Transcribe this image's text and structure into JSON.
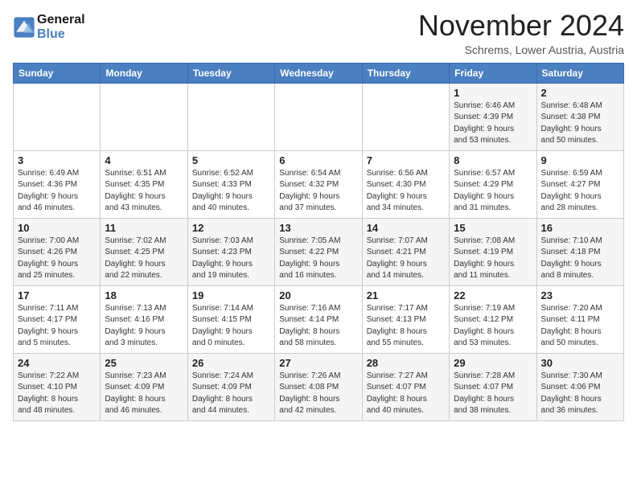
{
  "header": {
    "logo_line1": "General",
    "logo_line2": "Blue",
    "month": "November 2024",
    "location": "Schrems, Lower Austria, Austria"
  },
  "days_of_week": [
    "Sunday",
    "Monday",
    "Tuesday",
    "Wednesday",
    "Thursday",
    "Friday",
    "Saturday"
  ],
  "weeks": [
    [
      {
        "day": "",
        "info": ""
      },
      {
        "day": "",
        "info": ""
      },
      {
        "day": "",
        "info": ""
      },
      {
        "day": "",
        "info": ""
      },
      {
        "day": "",
        "info": ""
      },
      {
        "day": "1",
        "info": "Sunrise: 6:46 AM\nSunset: 4:39 PM\nDaylight: 9 hours\nand 53 minutes."
      },
      {
        "day": "2",
        "info": "Sunrise: 6:48 AM\nSunset: 4:38 PM\nDaylight: 9 hours\nand 50 minutes."
      }
    ],
    [
      {
        "day": "3",
        "info": "Sunrise: 6:49 AM\nSunset: 4:36 PM\nDaylight: 9 hours\nand 46 minutes."
      },
      {
        "day": "4",
        "info": "Sunrise: 6:51 AM\nSunset: 4:35 PM\nDaylight: 9 hours\nand 43 minutes."
      },
      {
        "day": "5",
        "info": "Sunrise: 6:52 AM\nSunset: 4:33 PM\nDaylight: 9 hours\nand 40 minutes."
      },
      {
        "day": "6",
        "info": "Sunrise: 6:54 AM\nSunset: 4:32 PM\nDaylight: 9 hours\nand 37 minutes."
      },
      {
        "day": "7",
        "info": "Sunrise: 6:56 AM\nSunset: 4:30 PM\nDaylight: 9 hours\nand 34 minutes."
      },
      {
        "day": "8",
        "info": "Sunrise: 6:57 AM\nSunset: 4:29 PM\nDaylight: 9 hours\nand 31 minutes."
      },
      {
        "day": "9",
        "info": "Sunrise: 6:59 AM\nSunset: 4:27 PM\nDaylight: 9 hours\nand 28 minutes."
      }
    ],
    [
      {
        "day": "10",
        "info": "Sunrise: 7:00 AM\nSunset: 4:26 PM\nDaylight: 9 hours\nand 25 minutes."
      },
      {
        "day": "11",
        "info": "Sunrise: 7:02 AM\nSunset: 4:25 PM\nDaylight: 9 hours\nand 22 minutes."
      },
      {
        "day": "12",
        "info": "Sunrise: 7:03 AM\nSunset: 4:23 PM\nDaylight: 9 hours\nand 19 minutes."
      },
      {
        "day": "13",
        "info": "Sunrise: 7:05 AM\nSunset: 4:22 PM\nDaylight: 9 hours\nand 16 minutes."
      },
      {
        "day": "14",
        "info": "Sunrise: 7:07 AM\nSunset: 4:21 PM\nDaylight: 9 hours\nand 14 minutes."
      },
      {
        "day": "15",
        "info": "Sunrise: 7:08 AM\nSunset: 4:19 PM\nDaylight: 9 hours\nand 11 minutes."
      },
      {
        "day": "16",
        "info": "Sunrise: 7:10 AM\nSunset: 4:18 PM\nDaylight: 9 hours\nand 8 minutes."
      }
    ],
    [
      {
        "day": "17",
        "info": "Sunrise: 7:11 AM\nSunset: 4:17 PM\nDaylight: 9 hours\nand 5 minutes."
      },
      {
        "day": "18",
        "info": "Sunrise: 7:13 AM\nSunset: 4:16 PM\nDaylight: 9 hours\nand 3 minutes."
      },
      {
        "day": "19",
        "info": "Sunrise: 7:14 AM\nSunset: 4:15 PM\nDaylight: 9 hours\nand 0 minutes."
      },
      {
        "day": "20",
        "info": "Sunrise: 7:16 AM\nSunset: 4:14 PM\nDaylight: 8 hours\nand 58 minutes."
      },
      {
        "day": "21",
        "info": "Sunrise: 7:17 AM\nSunset: 4:13 PM\nDaylight: 8 hours\nand 55 minutes."
      },
      {
        "day": "22",
        "info": "Sunrise: 7:19 AM\nSunset: 4:12 PM\nDaylight: 8 hours\nand 53 minutes."
      },
      {
        "day": "23",
        "info": "Sunrise: 7:20 AM\nSunset: 4:11 PM\nDaylight: 8 hours\nand 50 minutes."
      }
    ],
    [
      {
        "day": "24",
        "info": "Sunrise: 7:22 AM\nSunset: 4:10 PM\nDaylight: 8 hours\nand 48 minutes."
      },
      {
        "day": "25",
        "info": "Sunrise: 7:23 AM\nSunset: 4:09 PM\nDaylight: 8 hours\nand 46 minutes."
      },
      {
        "day": "26",
        "info": "Sunrise: 7:24 AM\nSunset: 4:09 PM\nDaylight: 8 hours\nand 44 minutes."
      },
      {
        "day": "27",
        "info": "Sunrise: 7:26 AM\nSunset: 4:08 PM\nDaylight: 8 hours\nand 42 minutes."
      },
      {
        "day": "28",
        "info": "Sunrise: 7:27 AM\nSunset: 4:07 PM\nDaylight: 8 hours\nand 40 minutes."
      },
      {
        "day": "29",
        "info": "Sunrise: 7:28 AM\nSunset: 4:07 PM\nDaylight: 8 hours\nand 38 minutes."
      },
      {
        "day": "30",
        "info": "Sunrise: 7:30 AM\nSunset: 4:06 PM\nDaylight: 8 hours\nand 36 minutes."
      }
    ]
  ]
}
